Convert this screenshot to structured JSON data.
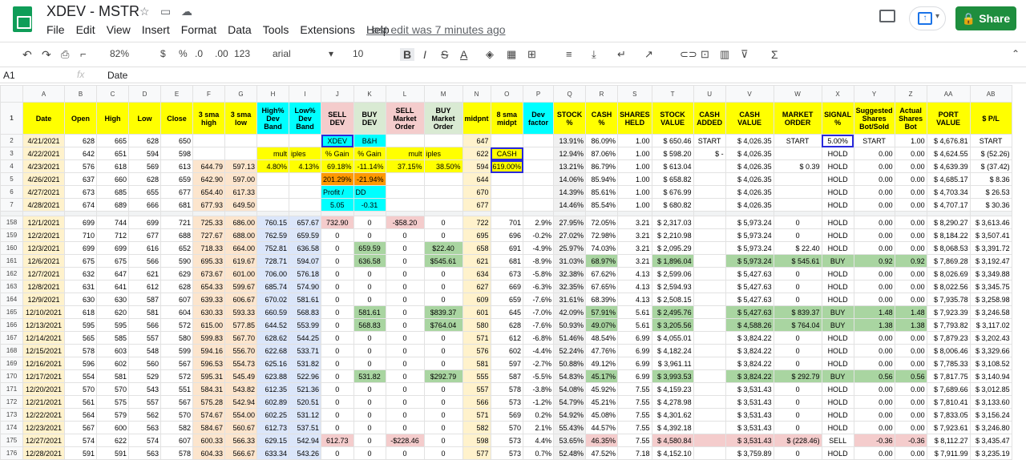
{
  "app": {
    "title": "XDEV - MSTR",
    "menu": [
      "File",
      "Edit",
      "View",
      "Insert",
      "Format",
      "Data",
      "Tools",
      "Extensions",
      "Help"
    ],
    "last_edit": "Last edit was 7 minutes ago",
    "share": "Share"
  },
  "toolbar": {
    "zoom": "82%",
    "currency": "$",
    "percent": "%",
    "dec_less": ".0",
    "dec_more": ".00",
    "format": "123",
    "font": "arial",
    "size": "10",
    "bold": "B",
    "italic": "I",
    "strike": "S",
    "textcolor": "A"
  },
  "formula": {
    "cell": "A1",
    "fx": "fx",
    "value": "Date"
  },
  "columns": [
    "A",
    "B",
    "C",
    "D",
    "E",
    "F",
    "G",
    "H",
    "I",
    "J",
    "K",
    "L",
    "M",
    "N",
    "O",
    "P",
    "Q",
    "R",
    "S",
    "T",
    "U",
    "V",
    "W",
    "X",
    "Y",
    "Z",
    "AA",
    "AB"
  ],
  "header_row": [
    "Date",
    "Open",
    "High",
    "Low",
    "Close",
    "3 sma high",
    "3 sma low",
    "High% Dev Band",
    "Low% Dev Band",
    "SELL DEV",
    "BUY DEV",
    "SELL Market Order",
    "BUY Market Order",
    "midpnt",
    "8 sma midpt",
    "Dev factor",
    "STOCK %",
    "CASH %",
    "SHARES HELD",
    "STOCK VALUE",
    "CASH ADDED",
    "CASH VALUE",
    "MARKET ORDER",
    "SIGNAL %",
    "Suggested Shares Bot/Sold",
    "Actual Shares Bot",
    "PORT VALUE",
    "$ P/L"
  ],
  "rows": [
    {
      "n": "2",
      "c": [
        "4/21/2021",
        "628",
        "665",
        "628",
        "650",
        "",
        "",
        "",
        "",
        "XDEV",
        "B&H",
        "",
        "",
        "647",
        "",
        "",
        "13.91%",
        "86.09%",
        "1.00",
        "$ 650.46",
        "START",
        "$ 4,026.35",
        "START",
        "5.00%",
        "START",
        "1.00",
        "$ 4,676.81",
        "START"
      ]
    },
    {
      "n": "3",
      "c": [
        "4/22/2021",
        "642",
        "651",
        "594",
        "598",
        "",
        "",
        "mult",
        "iples",
        "% Gain",
        "% Gain",
        "mult",
        "iples",
        "622",
        "CASH",
        "",
        "12.94%",
        "87.06%",
        "1.00",
        "$ 598.20",
        "$ -",
        "$ 4,026.35",
        "",
        "HOLD",
        "0.00",
        "0.00",
        "$ 4,624.55",
        "$ (52.26)"
      ]
    },
    {
      "n": "4",
      "c": [
        "4/23/2021",
        "576",
        "618",
        "569",
        "613",
        "644.79",
        "597.13",
        "4.80%",
        "4.13%",
        "69.18%",
        "-11.14%",
        "37.15%",
        "38.50%",
        "594",
        "619.00%",
        "",
        "13.21%",
        "86.79%",
        "1.00",
        "$ 613.04",
        "",
        "$ 4,026.35",
        "$ 0.39",
        "HOLD",
        "0.00",
        "0.00",
        "$ 4,639.39",
        "$ (37.42)"
      ]
    },
    {
      "n": "5",
      "c": [
        "4/26/2021",
        "637",
        "660",
        "628",
        "659",
        "642.90",
        "597.00",
        "",
        "",
        "201.29%",
        "-21.94%",
        "",
        "",
        "644",
        "",
        "",
        "14.06%",
        "85.94%",
        "1.00",
        "$ 658.82",
        "",
        "$ 4,026.35",
        "",
        "HOLD",
        "0.00",
        "0.00",
        "$ 4,685.17",
        "$ 8.36"
      ]
    },
    {
      "n": "6",
      "c": [
        "4/27/2021",
        "673",
        "685",
        "655",
        "677",
        "654.40",
        "617.33",
        "",
        "",
        "Profit /",
        "DD",
        "",
        "",
        "670",
        "",
        "",
        "14.39%",
        "85.61%",
        "1.00",
        "$ 676.99",
        "",
        "$ 4,026.35",
        "",
        "HOLD",
        "0.00",
        "0.00",
        "$ 4,703.34",
        "$ 26.53"
      ]
    },
    {
      "n": "7",
      "c": [
        "4/28/2021",
        "674",
        "689",
        "666",
        "681",
        "677.93",
        "649.50",
        "",
        "",
        "5.05",
        "-0.31",
        "",
        "",
        "677",
        "",
        "",
        "14.46%",
        "85.54%",
        "1.00",
        "$ 680.82",
        "",
        "$ 4,026.35",
        "",
        "HOLD",
        "0.00",
        "0.00",
        "$ 4,707.17",
        "$ 30.36"
      ]
    },
    {
      "n": "158",
      "c": [
        "12/1/2021",
        "699",
        "744",
        "699",
        "721",
        "725.33",
        "686.00",
        "760.15",
        "657.67",
        "732.90",
        "0",
        "-$58.20",
        "0",
        "722",
        "701",
        "2.9%",
        "27.95%",
        "72.05%",
        "3.21",
        "$ 2,317.03",
        "",
        "$ 5,973.24",
        "0",
        "HOLD",
        "0.00",
        "0.00",
        "$ 8,290.27",
        "$ 3,613.46"
      ]
    },
    {
      "n": "159",
      "c": [
        "12/2/2021",
        "710",
        "712",
        "677",
        "688",
        "727.67",
        "688.00",
        "762.59",
        "659.59",
        "0",
        "0",
        "0",
        "0",
        "695",
        "696",
        "-0.2%",
        "27.02%",
        "72.98%",
        "3.21",
        "$ 2,210.98",
        "",
        "$ 5,973.24",
        "0",
        "HOLD",
        "0.00",
        "0.00",
        "$ 8,184.22",
        "$ 3,507.41"
      ]
    },
    {
      "n": "160",
      "c": [
        "12/3/2021",
        "699",
        "699",
        "616",
        "652",
        "718.33",
        "664.00",
        "752.81",
        "636.58",
        "0",
        "659.59",
        "0",
        "$22.40",
        "658",
        "691",
        "-4.9%",
        "25.97%",
        "74.03%",
        "3.21",
        "$ 2,095.29",
        "",
        "$ 5,973.24",
        "$ 22.40",
        "HOLD",
        "0.00",
        "0.00",
        "$ 8,068.53",
        "$ 3,391.72"
      ]
    },
    {
      "n": "161",
      "c": [
        "12/6/2021",
        "675",
        "675",
        "566",
        "590",
        "695.33",
        "619.67",
        "728.71",
        "594.07",
        "0",
        "636.58",
        "0",
        "$545.61",
        "621",
        "681",
        "-8.9%",
        "31.03%",
        "68.97%",
        "3.21",
        "$ 1,896.04",
        "",
        "$ 5,973.24",
        "$ 545.61",
        "BUY",
        "0.92",
        "0.92",
        "$ 7,869.28",
        "$ 3,192.47"
      ]
    },
    {
      "n": "162",
      "c": [
        "12/7/2021",
        "632",
        "647",
        "621",
        "629",
        "673.67",
        "601.00",
        "706.00",
        "576.18",
        "0",
        "0",
        "0",
        "0",
        "634",
        "673",
        "-5.8%",
        "32.38%",
        "67.62%",
        "4.13",
        "$ 2,599.06",
        "",
        "$ 5,427.63",
        "0",
        "HOLD",
        "0.00",
        "0.00",
        "$ 8,026.69",
        "$ 3,349.88"
      ]
    },
    {
      "n": "163",
      "c": [
        "12/8/2021",
        "631",
        "641",
        "612",
        "628",
        "654.33",
        "599.67",
        "685.74",
        "574.90",
        "0",
        "0",
        "0",
        "0",
        "627",
        "669",
        "-6.3%",
        "32.35%",
        "67.65%",
        "4.13",
        "$ 2,594.93",
        "",
        "$ 5,427.63",
        "0",
        "HOLD",
        "0.00",
        "0.00",
        "$ 8,022.56",
        "$ 3,345.75"
      ]
    },
    {
      "n": "164",
      "c": [
        "12/9/2021",
        "630",
        "630",
        "587",
        "607",
        "639.33",
        "606.67",
        "670.02",
        "581.61",
        "0",
        "0",
        "0",
        "0",
        "609",
        "659",
        "-7.6%",
        "31.61%",
        "68.39%",
        "4.13",
        "$ 2,508.15",
        "",
        "$ 5,427.63",
        "0",
        "HOLD",
        "0.00",
        "0.00",
        "$ 7,935.78",
        "$ 3,258.98"
      ]
    },
    {
      "n": "165",
      "c": [
        "12/10/2021",
        "618",
        "620",
        "581",
        "604",
        "630.33",
        "593.33",
        "660.59",
        "568.83",
        "0",
        "581.61",
        "0",
        "$839.37",
        "601",
        "645",
        "-7.0%",
        "42.09%",
        "57.91%",
        "5.61",
        "$ 2,495.76",
        "",
        "$ 5,427.63",
        "$ 839.37",
        "BUY",
        "1.48",
        "1.48",
        "$ 7,923.39",
        "$ 3,246.58"
      ]
    },
    {
      "n": "166",
      "c": [
        "12/13/2021",
        "595",
        "595",
        "566",
        "572",
        "615.00",
        "577.85",
        "644.52",
        "553.99",
        "0",
        "568.83",
        "0",
        "$764.04",
        "580",
        "628",
        "-7.6%",
        "50.93%",
        "49.07%",
        "5.61",
        "$ 3,205.56",
        "",
        "$ 4,588.26",
        "$ 764.04",
        "BUY",
        "1.38",
        "1.38",
        "$ 7,793.82",
        "$ 3,117.02"
      ]
    },
    {
      "n": "167",
      "c": [
        "12/14/2021",
        "565",
        "585",
        "557",
        "580",
        "599.83",
        "567.70",
        "628.62",
        "544.25",
        "0",
        "0",
        "0",
        "0",
        "571",
        "612",
        "-6.8%",
        "51.46%",
        "48.54%",
        "6.99",
        "$ 4,055.01",
        "",
        "$ 3,824.22",
        "0",
        "HOLD",
        "0.00",
        "0.00",
        "$ 7,879.23",
        "$ 3,202.43"
      ]
    },
    {
      "n": "168",
      "c": [
        "12/15/2021",
        "578",
        "603",
        "548",
        "599",
        "594.16",
        "556.70",
        "622.68",
        "533.71",
        "0",
        "0",
        "0",
        "0",
        "576",
        "602",
        "-4.4%",
        "52.24%",
        "47.76%",
        "6.99",
        "$ 4,182.24",
        "",
        "$ 3,824.22",
        "0",
        "HOLD",
        "0.00",
        "0.00",
        "$ 8,006.46",
        "$ 3,329.66"
      ]
    },
    {
      "n": "169",
      "c": [
        "12/16/2021",
        "596",
        "602",
        "560",
        "567",
        "596.53",
        "554.73",
        "625.16",
        "531.82",
        "0",
        "0",
        "0",
        "0",
        "581",
        "597",
        "-2.7%",
        "50.88%",
        "49.12%",
        "6.99",
        "$ 3,961.11",
        "",
        "$ 3,824.22",
        "0",
        "HOLD",
        "0.00",
        "0.00",
        "$ 7,785.33",
        "$ 3,108.52"
      ]
    },
    {
      "n": "170",
      "c": [
        "12/17/2021",
        "554",
        "581",
        "529",
        "572",
        "595.31",
        "545.49",
        "623.88",
        "522.96",
        "0",
        "531.82",
        "0",
        "$292.79",
        "555",
        "587",
        "-5.5%",
        "54.83%",
        "45.17%",
        "6.99",
        "$ 3,993.53",
        "",
        "$ 3,824.22",
        "$ 292.79",
        "BUY",
        "0.56",
        "0.56",
        "$ 7,817.75",
        "$ 3,140.94"
      ]
    },
    {
      "n": "171",
      "c": [
        "12/20/2021",
        "570",
        "570",
        "543",
        "551",
        "584.31",
        "543.82",
        "612.35",
        "521.36",
        "0",
        "0",
        "0",
        "0",
        "557",
        "578",
        "-3.8%",
        "54.08%",
        "45.92%",
        "7.55",
        "$ 4,159.23",
        "",
        "$ 3,531.43",
        "0",
        "HOLD",
        "0.00",
        "0.00",
        "$ 7,689.66",
        "$ 3,012.85"
      ]
    },
    {
      "n": "172",
      "c": [
        "12/21/2021",
        "561",
        "575",
        "557",
        "567",
        "575.28",
        "542.94",
        "602.89",
        "520.51",
        "0",
        "0",
        "0",
        "0",
        "566",
        "573",
        "-1.2%",
        "54.79%",
        "45.21%",
        "7.55",
        "$ 4,278.98",
        "",
        "$ 3,531.43",
        "0",
        "HOLD",
        "0.00",
        "0.00",
        "$ 7,810.41",
        "$ 3,133.60"
      ]
    },
    {
      "n": "173",
      "c": [
        "12/22/2021",
        "564",
        "579",
        "562",
        "570",
        "574.67",
        "554.00",
        "602.25",
        "531.12",
        "0",
        "0",
        "0",
        "0",
        "571",
        "569",
        "0.2%",
        "54.92%",
        "45.08%",
        "7.55",
        "$ 4,301.62",
        "",
        "$ 3,531.43",
        "0",
        "HOLD",
        "0.00",
        "0.00",
        "$ 7,833.05",
        "$ 3,156.24"
      ]
    },
    {
      "n": "174",
      "c": [
        "12/23/2021",
        "567",
        "600",
        "563",
        "582",
        "584.67",
        "560.67",
        "612.73",
        "537.51",
        "0",
        "0",
        "0",
        "0",
        "582",
        "570",
        "2.1%",
        "55.43%",
        "44.57%",
        "7.55",
        "$ 4,392.18",
        "",
        "$ 3,531.43",
        "0",
        "HOLD",
        "0.00",
        "0.00",
        "$ 7,923.61",
        "$ 3,246.80"
      ]
    },
    {
      "n": "175",
      "c": [
        "12/27/2021",
        "574",
        "622",
        "574",
        "607",
        "600.33",
        "566.33",
        "629.15",
        "542.94",
        "612.73",
        "0",
        "-$228.46",
        "0",
        "598",
        "573",
        "4.4%",
        "53.65%",
        "46.35%",
        "7.55",
        "$ 4,580.84",
        "",
        "$ 3,531.43",
        "$ (228.46)",
        "SELL",
        "-0.36",
        "-0.36",
        "$ 8,112.27",
        "$ 3,435.47"
      ]
    },
    {
      "n": "176",
      "c": [
        "12/28/2021",
        "591",
        "591",
        "563",
        "578",
        "604.33",
        "566.67",
        "633.34",
        "543.26",
        "0",
        "0",
        "0",
        "0",
        "577",
        "573",
        "0.7%",
        "52.48%",
        "47.52%",
        "7.18",
        "$ 4,152.10",
        "",
        "$ 3,759.89",
        "0",
        "HOLD",
        "0.00",
        "0.00",
        "$ 7,911.99",
        "$ 3,235.19"
      ]
    }
  ],
  "colors": {
    "yellow": "#ffff00",
    "cyan": "#00ffff",
    "pink": "#f4cccc",
    "green": "#a9d5a1",
    "blue_text": "#1a1aff",
    "red_text": "#e00000"
  }
}
